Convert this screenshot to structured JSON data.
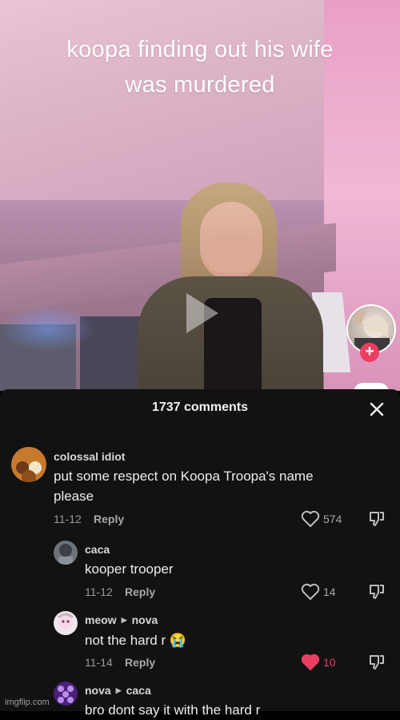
{
  "video": {
    "caption_line1": "koopa finding out his wife",
    "caption_line2": "was murdered",
    "follow_plus": "+"
  },
  "comments_panel": {
    "title": "1737 comments",
    "accent_like_color": "#ea3e63",
    "comments": [
      {
        "username": "colossal idiot",
        "text_line1": "put some respect on Koopa Troopa's name",
        "text_line2": "please",
        "date": "11-12",
        "reply_label": "Reply",
        "likes": "574",
        "liked": false
      },
      {
        "username": "caca",
        "text_line1": "kooper trooper",
        "date": "11-12",
        "reply_label": "Reply",
        "likes": "14",
        "liked": false
      },
      {
        "username": "meow",
        "reply_to": "nova",
        "text_line1": "not the hard r",
        "emoji": "😭",
        "date": "11-14",
        "reply_label": "Reply",
        "likes": "10",
        "liked": true
      },
      {
        "username": "nova",
        "reply_to": "caca",
        "text_line1": "bro dont say it with the hard r"
      }
    ]
  },
  "watermark": "imgflip.com"
}
